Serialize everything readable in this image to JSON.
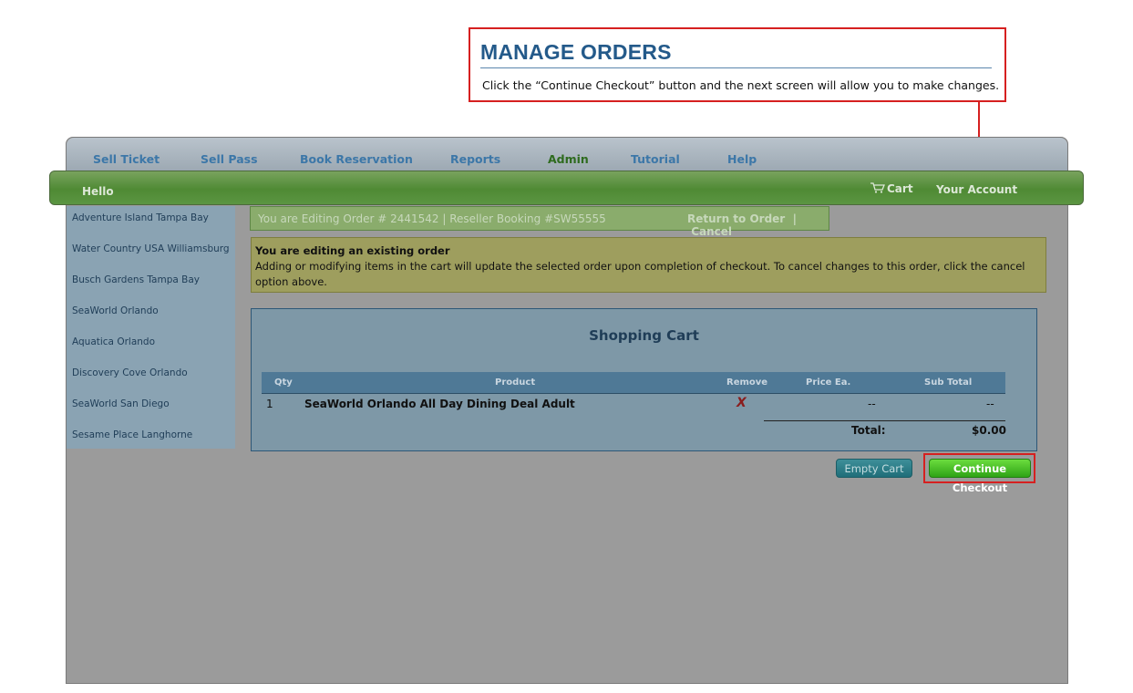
{
  "callout": {
    "title": "MANAGE ORDERS",
    "text": "Click the “Continue Checkout” button and the next screen will allow you to make changes."
  },
  "topnav": {
    "items": [
      {
        "label": "Sell Ticket"
      },
      {
        "label": "Sell Pass"
      },
      {
        "label": "Book Reservation"
      },
      {
        "label": "Reports"
      },
      {
        "label": "Admin",
        "active": true
      },
      {
        "label": "Tutorial"
      },
      {
        "label": "Help"
      }
    ]
  },
  "header": {
    "greeting": "Hello",
    "cart_label": "Cart",
    "account_label": "Your Account"
  },
  "sidebar": {
    "items": [
      {
        "label": "Adventure Island Tampa Bay"
      },
      {
        "label": "Water Country USA Williamsburg"
      },
      {
        "label": "Busch Gardens Tampa Bay"
      },
      {
        "label": "SeaWorld Orlando"
      },
      {
        "label": "Aquatica Orlando"
      },
      {
        "label": "Discovery Cove Orlando"
      },
      {
        "label": "SeaWorld San Diego"
      },
      {
        "label": "Sesame Place Langhorne"
      }
    ]
  },
  "editbar": {
    "text": "You are Editing Order # 2441542  | Reseller Booking #SW55555",
    "return_label": "Return to Order",
    "separator": "|",
    "cancel_label": "Cancel"
  },
  "notice": {
    "title": "You are editing an existing order",
    "body": "Adding or modifying items in the cart will update the selected order upon completion of checkout. To cancel changes to this order, click the cancel option above."
  },
  "cart": {
    "title": "Shopping Cart",
    "columns": {
      "qty": "Qty",
      "product": "Product",
      "remove": "Remove",
      "price": "Price Ea.",
      "subtotal": "Sub Total"
    },
    "rows": [
      {
        "qty": "1",
        "product": "SeaWorld Orlando All Day Dining Deal Adult",
        "remove": "X",
        "price": "--",
        "subtotal": "--"
      }
    ],
    "total_label": "Total:",
    "total_value": "$0.00"
  },
  "buttons": {
    "empty_cart": "Empty Cart",
    "continue_checkout": "Continue Checkout"
  },
  "colors": {
    "callout_border": "#d62020",
    "callout_title": "#245a8a",
    "nav_text": "#3c77a8",
    "green_bar": "#5b9542",
    "checkout_button": "#2fa316"
  }
}
